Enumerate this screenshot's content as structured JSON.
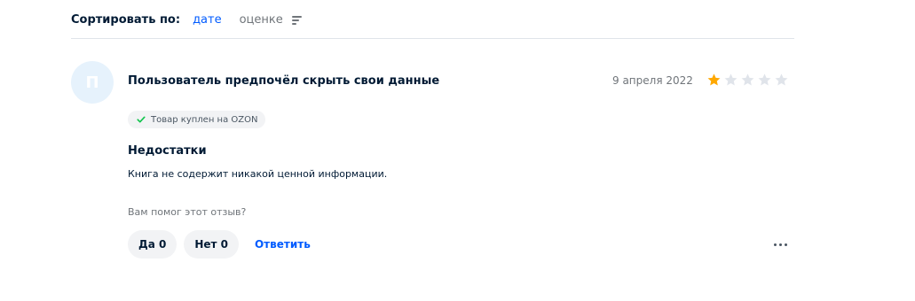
{
  "sort": {
    "label": "Сортировать по:",
    "options": [
      {
        "label": "дате",
        "active": true
      },
      {
        "label": "оценке",
        "active": false
      }
    ],
    "icon": "sort-lines-icon"
  },
  "review": {
    "avatar_letter": "П",
    "author": "Пользователь предпочёл скрыть свои данные",
    "date": "9 апреля 2022",
    "rating": 1,
    "rating_max": 5,
    "badge": "Товар куплен на OZON",
    "section_title": "Недостатки",
    "section_text": "Книга не содержит никакой ценной информации.",
    "helpful_question": "Вам помог этот отзыв?",
    "yes_label": "Да 0",
    "no_label": "Нет 0",
    "reply_label": "Ответить"
  },
  "colors": {
    "accent": "#005bff",
    "star_filled": "#ffa800",
    "star_empty": "#e0e4ea",
    "check": "#10c44c"
  }
}
